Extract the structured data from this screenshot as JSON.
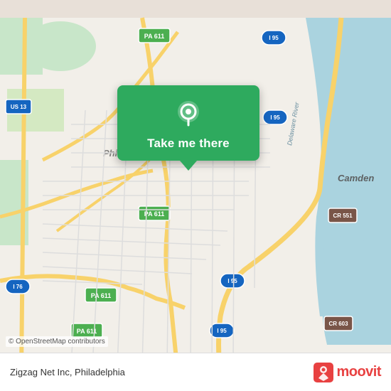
{
  "map": {
    "background_color": "#e8e0d8",
    "alt": "OpenStreetMap of Philadelphia area"
  },
  "popup": {
    "label": "Take me there",
    "background_color": "#2eaa5e",
    "pin_icon": "location-pin"
  },
  "copyright": {
    "text": "© OpenStreetMap contributors"
  },
  "bottom_bar": {
    "location_text": "Zigzag Net Inc, Philadelphia",
    "logo_name": "moovit"
  }
}
